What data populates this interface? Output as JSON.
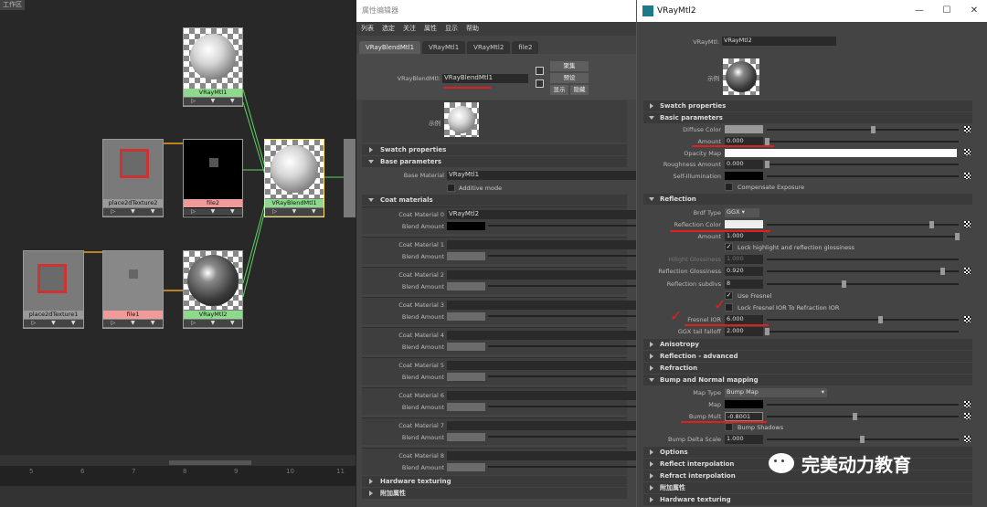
{
  "node_editor": {
    "tab": "工作区",
    "nodes": {
      "vraymtl1": "VRayMtl1",
      "place2d2": "place2dTexture2",
      "file2": "file2",
      "blend": "VRayBlendMtl1",
      "place2d1": "place2dTexture1",
      "file1": "file1",
      "vraymtl2": "VRayMtl2"
    },
    "ruler_ticks": [
      "5",
      "6",
      "7",
      "8",
      "9",
      "10",
      "11"
    ]
  },
  "attr_editor": {
    "title": "属性编辑器",
    "menu": [
      "列表",
      "选定",
      "关注",
      "属性",
      "显示",
      "帮助"
    ],
    "tabs": [
      "VRayBlendMtl1",
      "VRayMtl1",
      "VRayMtl2",
      "file2"
    ],
    "name_label": "VRayBlendMtl:",
    "name_value": "VRayBlendMtl1",
    "buttons": {
      "focus": "聚集",
      "presets": "预设",
      "show": "显示",
      "hide": "隐藏"
    },
    "sample_label": "示例",
    "sections": {
      "swatch": "Swatch properties",
      "base": "Base parameters",
      "coat": "Coat materials",
      "hw": "Hardware texturing",
      "extra": "附加属性"
    },
    "base_material_label": "Base Material",
    "base_material_value": "VRayMtl1",
    "additive_label": "Additive mode",
    "coats": [
      {
        "label": "Coat Material 0",
        "value": "VRayMtl2",
        "blend": "Blend Amount"
      },
      {
        "label": "Coat Material 1",
        "value": "",
        "blend": "Blend Amount"
      },
      {
        "label": "Coat Material 2",
        "value": "",
        "blend": "Blend Amount"
      },
      {
        "label": "Coat Material 3",
        "value": "",
        "blend": "Blend Amount"
      },
      {
        "label": "Coat Material 4",
        "value": "",
        "blend": "Blend Amount"
      },
      {
        "label": "Coat Material 5",
        "value": "",
        "blend": "Blend Amount"
      },
      {
        "label": "Coat Material 6",
        "value": "",
        "blend": "Blend Amount"
      },
      {
        "label": "Coat Material 7",
        "value": "",
        "blend": "Blend Amount"
      },
      {
        "label": "Coat Material 8",
        "value": "",
        "blend": "Blend Amount"
      }
    ]
  },
  "vray": {
    "title": "VRayMtl2",
    "controls": {
      "min": "—",
      "max": "☐",
      "close": "✕"
    },
    "name_label": "VRayMtl:",
    "name_value": "VRayMtl2",
    "sample_label": "示例",
    "sections": {
      "swatch": "Swatch properties",
      "basic": "Basic parameters",
      "reflection": "Reflection",
      "aniso": "Anisotropy",
      "refl_adv": "Reflection - advanced",
      "refraction": "Refraction",
      "bump": "Bump and Normal mapping",
      "options": "Options",
      "reflect_interp": "Reflect interpolation",
      "refract_interp": "Refract interpolation",
      "extra": "附加属性",
      "hw": "Hardware texturing"
    },
    "basic": {
      "diffuse_color": "Diffuse Color",
      "amount": "Amount",
      "amount_value": "0.000",
      "opacity_map": "Opacity Map",
      "roughness": "Roughness Amount",
      "roughness_value": "0.000",
      "self_illum": "Self-Illumination",
      "comp_exposure": "Compensate Exposure"
    },
    "reflection": {
      "brdf_type": "Brdf Type",
      "brdf_value": "GGX",
      "refl_color": "Reflection Color",
      "amount": "Amount",
      "amount_value": "1.000",
      "lock_hl": "Lock highlight and reflection glossiness",
      "hilight_gloss": "Hilight Glossiness",
      "hilight_value": "1.000",
      "refl_gloss": "Reflection Glossiness",
      "refl_gloss_value": "0.920",
      "refl_subdivs": "Reflection subdivs",
      "refl_subdivs_value": "8",
      "use_fresnel": "Use Fresnel",
      "lock_fresnel": "Lock Fresnel IOR To Refraction IOR",
      "fresnel_ior": "Fresnel IOR",
      "fresnel_value": "6.000",
      "ggx_tail": "GGX tail falloff",
      "ggx_value": "2.000"
    },
    "bump": {
      "map_type": "Map Type",
      "map_type_value": "Bump Map",
      "map": "Map",
      "bump_mult": "Bump Mult",
      "bump_mult_value": "-0.8001",
      "bump_shadows": "Bump Shadows",
      "bump_delta": "Bump Delta Scale",
      "bump_delta_value": "1.000"
    },
    "watermark": "完美动力教育",
    "colors": {
      "accent_red": "#e02020"
    }
  }
}
